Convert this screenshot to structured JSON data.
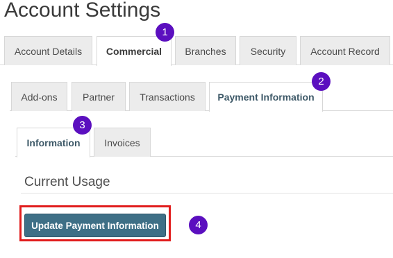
{
  "page": {
    "title": "Account Settings"
  },
  "tabs_level1": [
    "Account Details",
    "Commercial",
    "Branches",
    "Security",
    "Account Record"
  ],
  "tabs_level2": [
    "Add-ons",
    "Partner",
    "Transactions",
    "Payment Information"
  ],
  "tabs_level3": [
    "Information",
    "Invoices"
  ],
  "section": {
    "title": "Current Usage"
  },
  "actions": {
    "update_payment_label": "Update Payment Information"
  },
  "badges": [
    "1",
    "2",
    "3",
    "4"
  ],
  "colors": {
    "primary_button": "#3e6f86",
    "highlight_border": "#e11c1c",
    "badge": "#5b0fbf",
    "active_tab_text": "#3e5968"
  }
}
